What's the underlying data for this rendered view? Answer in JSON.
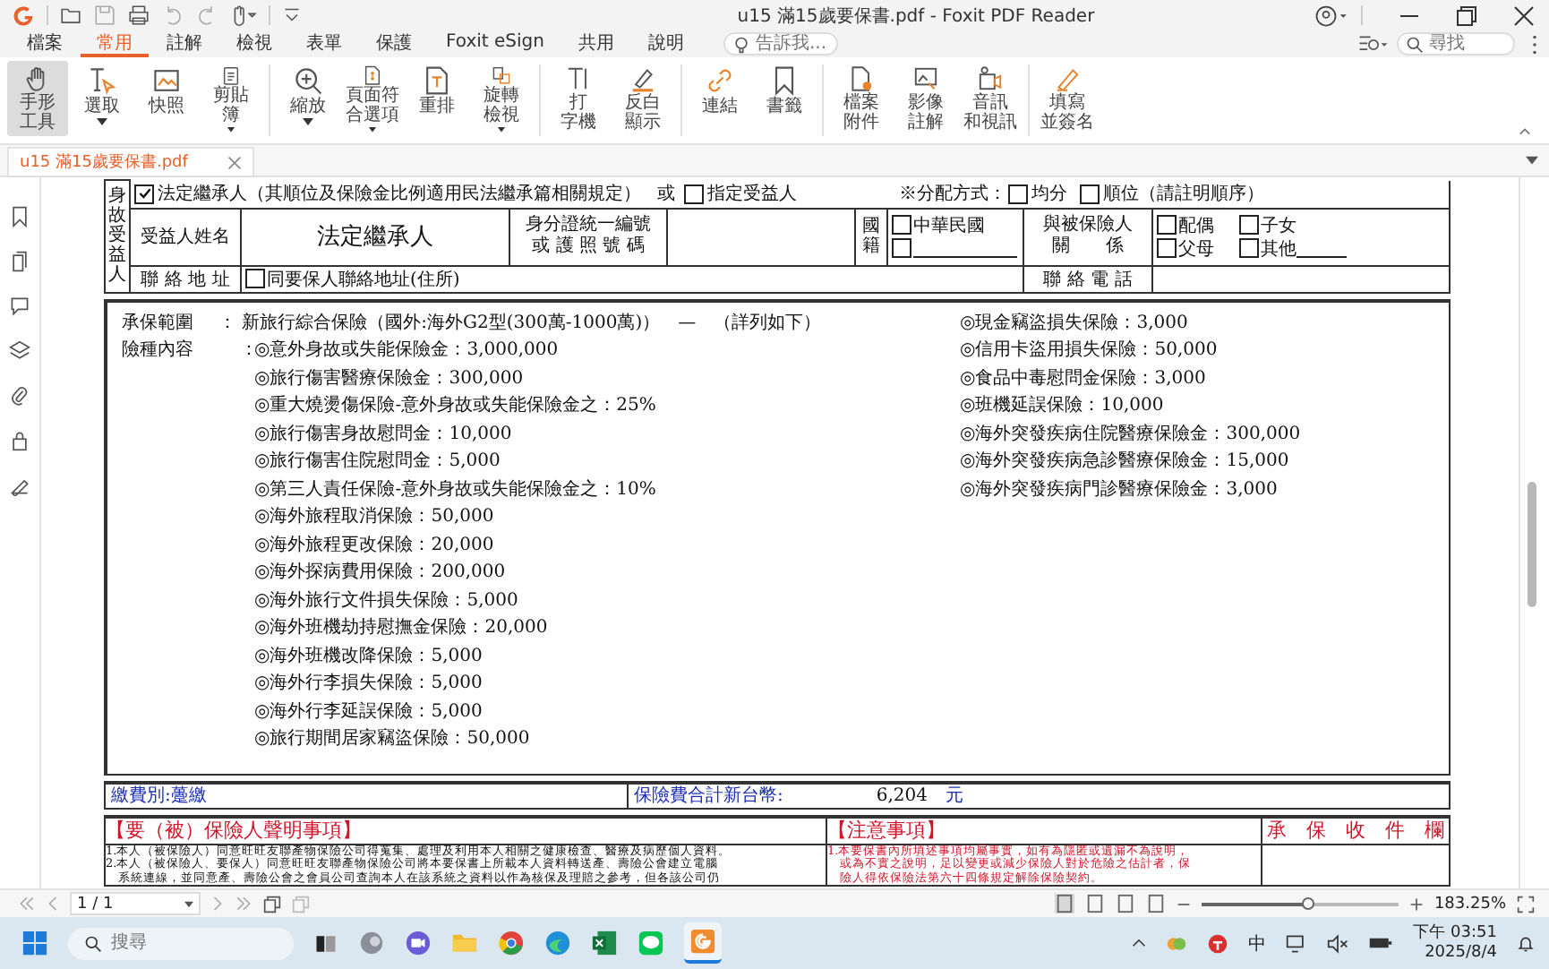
{
  "window": {
    "title": "u15 滿15歲要保書.pdf - Foxit PDF Reader"
  },
  "menu_tabs": [
    {
      "label": "檔案",
      "selected": false
    },
    {
      "label": "常用",
      "selected": true
    },
    {
      "label": "註解",
      "selected": false
    },
    {
      "label": "檢視",
      "selected": false
    },
    {
      "label": "表單",
      "selected": false
    },
    {
      "label": "保護",
      "selected": false
    },
    {
      "label": "Foxit eSign",
      "selected": false
    },
    {
      "label": "共用",
      "selected": false
    },
    {
      "label": "說明",
      "selected": false
    }
  ],
  "tell_me": {
    "placeholder": "告訴我..."
  },
  "find": {
    "placeholder": "尋找"
  },
  "ribbon_groups": [
    [
      {
        "lines": [
          "手形",
          "工具"
        ],
        "selected": true,
        "has_menu": false
      },
      {
        "lines": [
          "選取"
        ],
        "selected": false,
        "has_menu": true
      },
      {
        "lines": [
          "快照"
        ],
        "selected": false,
        "has_menu": false
      },
      {
        "lines": [
          "剪貼",
          "簿"
        ],
        "selected": false,
        "has_menu": true
      }
    ],
    [
      {
        "lines": [
          "縮放"
        ],
        "selected": false,
        "has_menu": true
      },
      {
        "lines": [
          "頁面符",
          "合選項"
        ],
        "selected": false,
        "has_menu": true
      },
      {
        "lines": [
          "重排"
        ],
        "selected": false,
        "has_menu": false
      },
      {
        "lines": [
          "旋轉",
          "檢視"
        ],
        "selected": false,
        "has_menu": true
      }
    ],
    [
      {
        "lines": [
          "打",
          "字機"
        ],
        "selected": false,
        "has_menu": false
      },
      {
        "lines": [
          "反白",
          "顯示"
        ],
        "selected": false,
        "has_menu": false
      }
    ],
    [
      {
        "lines": [
          "連結"
        ],
        "selected": false,
        "has_menu": false
      },
      {
        "lines": [
          "書籤"
        ],
        "selected": false,
        "has_menu": false
      }
    ],
    [
      {
        "lines": [
          "檔案",
          "附件"
        ],
        "selected": false,
        "has_menu": false
      },
      {
        "lines": [
          "影像",
          "註解"
        ],
        "selected": false,
        "has_menu": false
      },
      {
        "lines": [
          "音訊",
          "和視訊"
        ],
        "selected": false,
        "has_menu": false
      }
    ],
    [
      {
        "lines": [
          "填寫",
          "並簽名"
        ],
        "selected": false,
        "has_menu": false
      }
    ]
  ],
  "doc_tab": {
    "label": "u15 滿15歲要保書.pdf"
  },
  "beneficiary": {
    "side_label": "身故受益人",
    "row1": {
      "legal": {
        "label": "法定繼承人（其順位及保險金比例適用民法繼承篇相關規定）",
        "checked": true
      },
      "or": "或",
      "designated": {
        "label": "指定受益人",
        "checked": false
      },
      "method_label": "※分配方式：",
      "methods": [
        {
          "label": "均分",
          "checked": false
        },
        {
          "label": "順位（請註明順序）",
          "checked": false
        }
      ]
    },
    "name_label": "受益人姓名",
    "name_value": "法定繼承人",
    "id_label": [
      "身分證統一編號",
      "或 護 照 號 碼"
    ],
    "nationality_label": "國籍",
    "nationalities": [
      {
        "label": "中華民國",
        "checked": false
      },
      {
        "checked": false
      }
    ],
    "relation_label": [
      "與被保險人",
      "關　　係"
    ],
    "relations": [
      {
        "label": "配偶",
        "checked": false
      },
      {
        "label": "子女",
        "checked": false
      },
      {
        "label": "父母",
        "checked": false
      },
      {
        "label": "其他",
        "checked": false
      }
    ],
    "address_label": "聯 絡 地 址",
    "same_address": {
      "label": "同要保人聯絡地址(住所)",
      "checked": false
    },
    "phone_label": "聯 絡 電 話"
  },
  "coverage": {
    "scope_label": "承保範圍",
    "scope_value": "：  新旅行綜合保險（國外:海外G2型(300萬-1000萬)）　—　（詳列如下）",
    "items_label": "險種內容",
    "items_colon": "：",
    "left_items": [
      "◎意外身故或失能保險金：3,000,000",
      "◎旅行傷害醫療保險金：300,000",
      "◎重大燒燙傷保險-意外身故或失能保險金之：25%",
      "◎旅行傷害身故慰問金：10,000",
      "◎旅行傷害住院慰問金：5,000",
      "◎第三人責任保險-意外身故或失能保險金之：10%",
      "◎海外旅程取消保險：50,000",
      "◎海外旅程更改保險：20,000",
      "◎海外探病費用保險：200,000",
      "◎海外旅行文件損失保險：5,000",
      "◎海外班機劫持慰撫金保險：20,000",
      "◎海外班機改降保險：5,000",
      "◎海外行李損失保險：5,000",
      "◎海外行李延誤保險：5,000",
      "◎旅行期間居家竊盜保險：50,000"
    ],
    "right_items": [
      "◎現金竊盜損失保險：3,000",
      "◎信用卡盜用損失保險：50,000",
      "◎食品中毒慰問金保險：3,000",
      "◎班機延誤保險：10,000",
      "◎海外突發疾病住院醫療保險金：300,000",
      "◎海外突發疾病急診醫療保險金：15,000",
      "◎海外突發疾病門診醫療保險金：3,000"
    ]
  },
  "payment": {
    "method": "繳費別:躉繳",
    "total_label": "保險費合計新台幣:",
    "total_value": "6,204",
    "unit": "元"
  },
  "notices": {
    "declaration_title": "【要（被）保險人聲明事項】",
    "declaration_lines": [
      "1.本人（被保險人）同意旺旺友聯產物保險公司得蒐集、處理及利用本人相關之健康檢查、醫療及病歷個人資料。",
      "2.本人（被保險人、要保人）同意旺旺友聯產物保險公司將本要保書上所載本人資料轉送產、壽險公會建立電腦",
      "　系統連線，並同意產、壽險公會之會員公司查詢本人在該系統之資料以作為核保及理賠之參考，但各該公司仍"
    ],
    "notes_title": "【注意事項】",
    "notes_lines": [
      "1.本要保書內所填述事項均屬事實，如有為隱匿或遺漏不為說明，",
      "　或為不實之說明，足以變更或減少保險人對於危險之估計者，保",
      "　險人得依保險法第六十四條規定解除保險契約。"
    ],
    "receipt_title": "承　保　收　件　欄"
  },
  "status_bar": {
    "page": "1 / 1",
    "zoom": "183.25%",
    "zoom_slider": {
      "level": 0.55
    }
  },
  "taskbar": {
    "search_placeholder": "搜尋",
    "ime": "中",
    "time": "下午 03:51",
    "date": "2025/8/4"
  }
}
